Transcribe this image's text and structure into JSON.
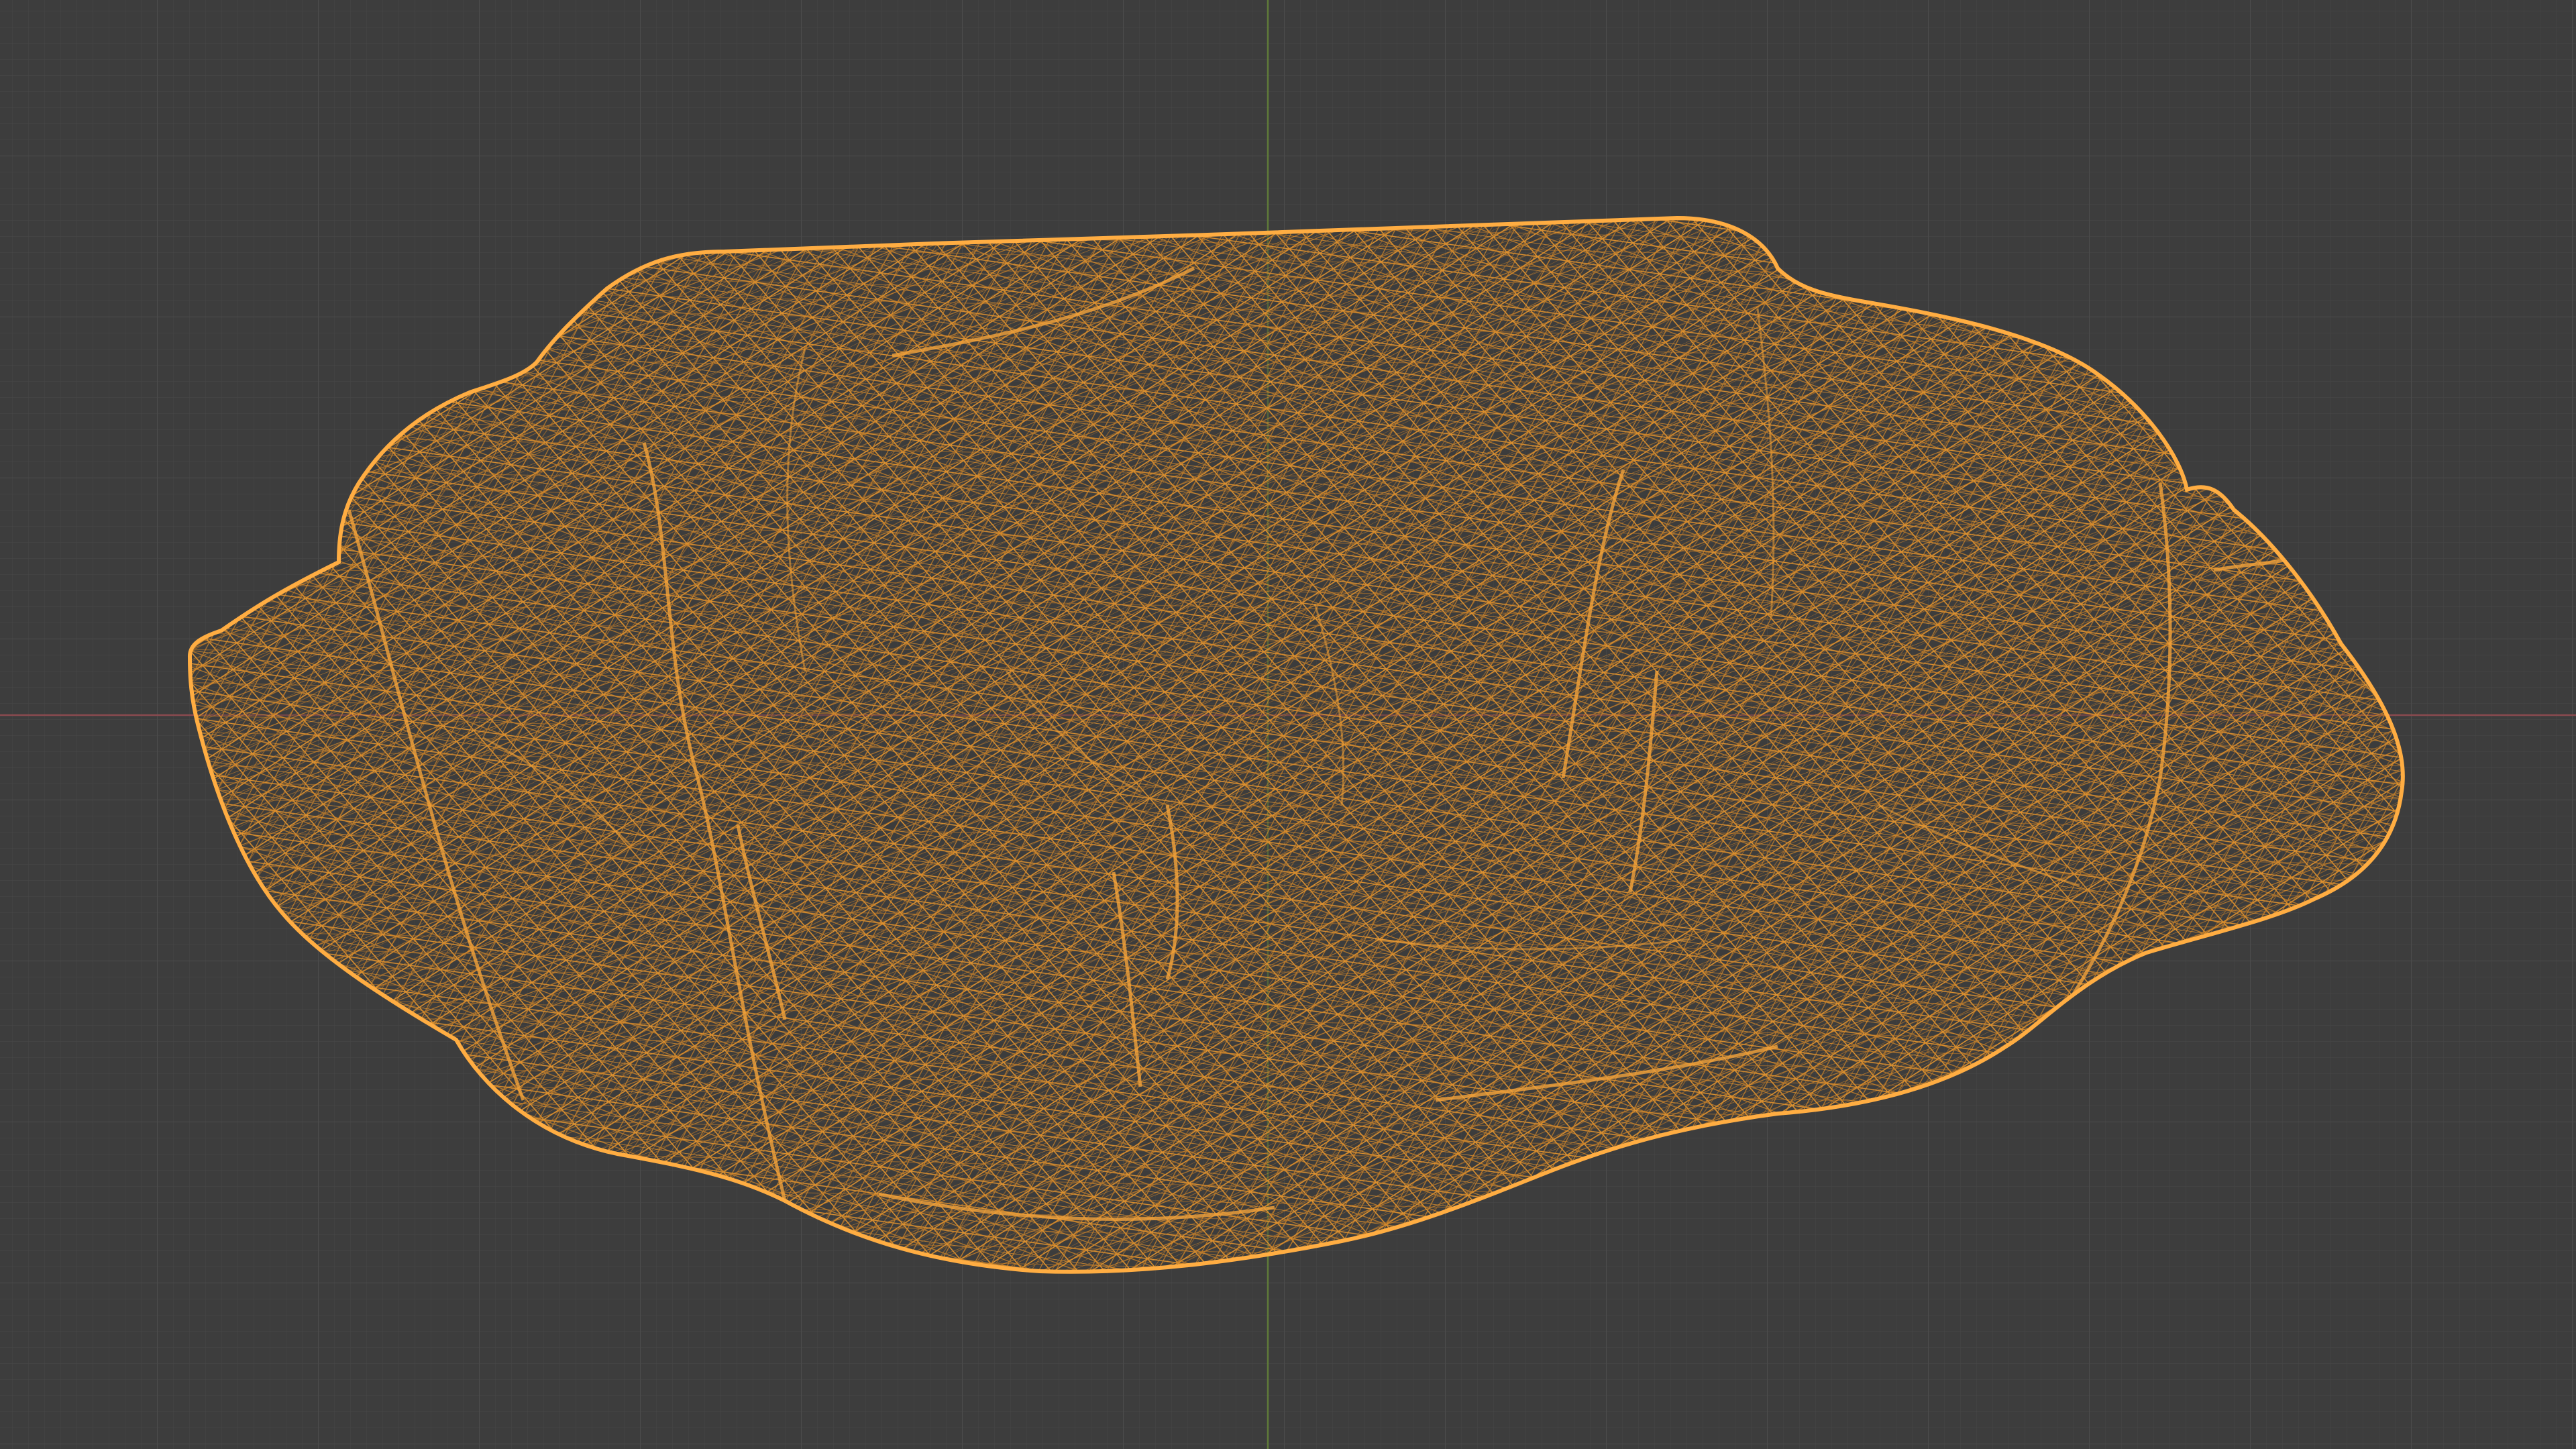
{
  "viewport": {
    "view_mode": "wireframe",
    "object_selected": true,
    "colors": {
      "background": "#3d3d3d",
      "grid_minor": "#464646",
      "grid_major": "#4c4c4c",
      "axis_x": "#8a4a4f",
      "axis_y": "#5f7a39",
      "selected_wire": "#f5a33a",
      "selected_outline": "#ffad42"
    },
    "object": {
      "icon": "rock-mesh-icon"
    }
  }
}
